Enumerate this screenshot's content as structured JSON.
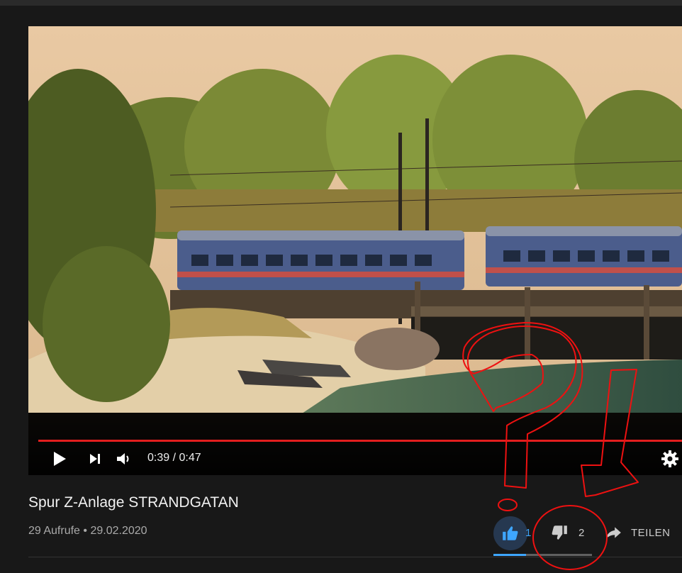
{
  "player": {
    "time_current": "0:39",
    "time_separator": "/",
    "time_total": "0:47",
    "progress_fraction": 0.83
  },
  "video": {
    "title": "Spur Z-Anlage STRANDGATAN",
    "views": "29 Aufrufe",
    "meta_separator": "•",
    "date": "29.02.2020"
  },
  "actions": {
    "like_count": "1",
    "dislike_count": "2",
    "share_label": "TEILEN",
    "like_ratio": 0.33
  },
  "colors": {
    "accent_blue": "#3ea6ff",
    "progress_red": "#e31e1e",
    "annotation_red": "#ee1111"
  },
  "icons": [
    "play-icon",
    "next-icon",
    "volume-icon",
    "settings-icon",
    "thumbs-up-icon",
    "thumbs-down-icon",
    "share-icon"
  ]
}
